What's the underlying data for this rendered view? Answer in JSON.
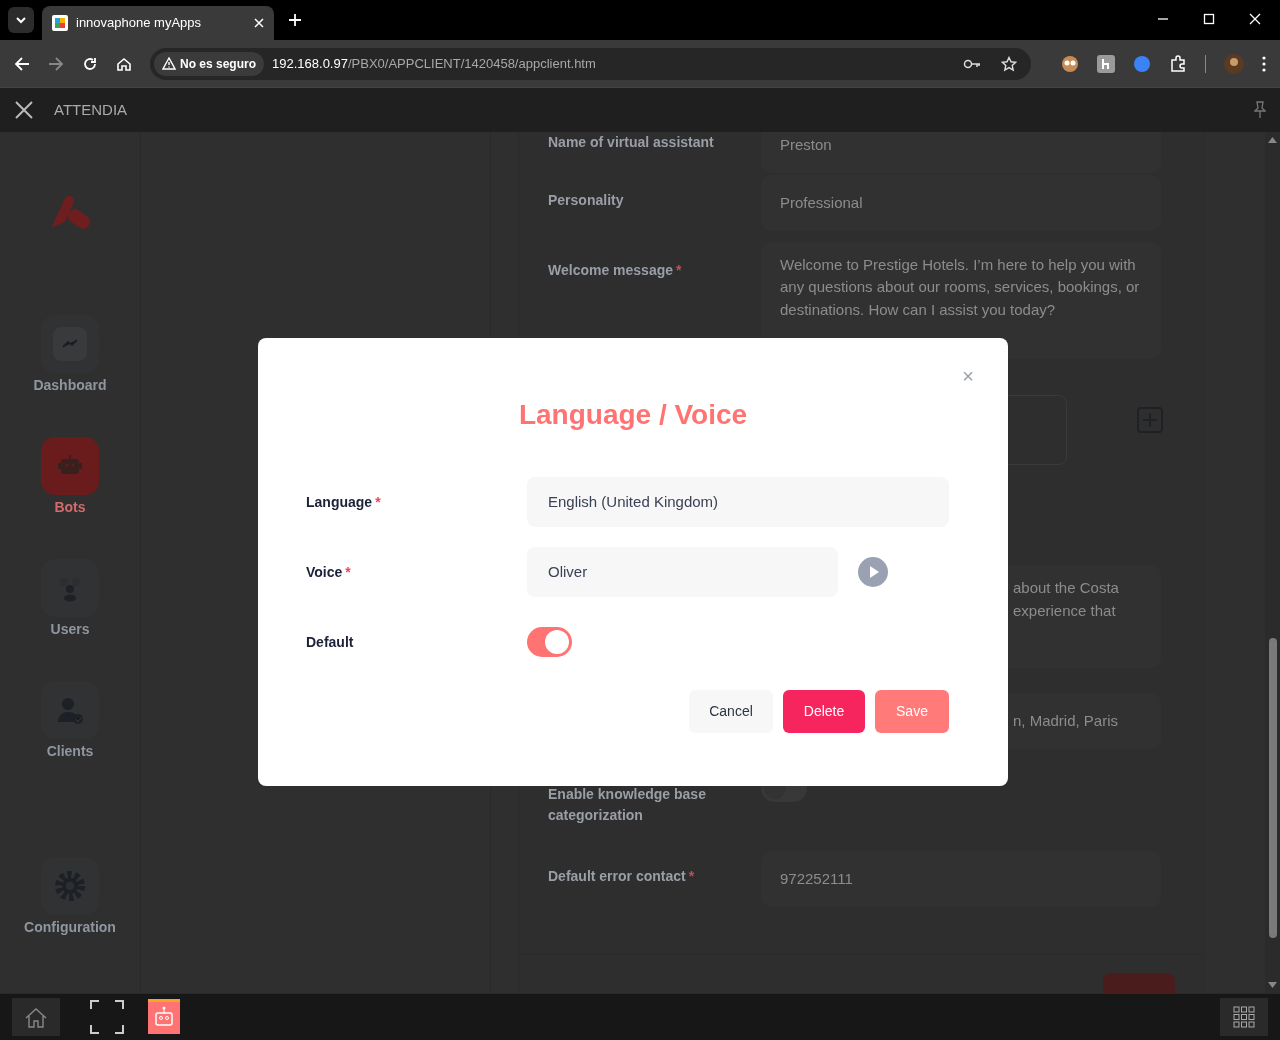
{
  "browser": {
    "tab_title": "innovaphone myApps",
    "security_label": "No es seguro",
    "url_host": "192.168.0.97",
    "url_path": "/PBX0/APPCLIENT/1420458/appclient.htm"
  },
  "app_header": {
    "title": "ATTENDIA"
  },
  "sidebar": {
    "items": [
      {
        "kind": "dashboard",
        "label": "Dashboard",
        "selected": false
      },
      {
        "kind": "bots",
        "label": "Bots",
        "selected": true
      },
      {
        "kind": "users",
        "label": "Users",
        "selected": false
      },
      {
        "kind": "clients",
        "label": "Clients",
        "selected": false
      },
      {
        "kind": "configuration",
        "label": "Configuration",
        "selected": false
      }
    ]
  },
  "background_form": {
    "fields": [
      {
        "kind": "text",
        "label": "Name of virtual assistant",
        "value": "Preston"
      },
      {
        "kind": "text",
        "label": "Personality",
        "value": "Professional"
      },
      {
        "kind": "textarea",
        "label": "Welcome message",
        "required_mark": "*",
        "value": "Welcome to Prestige Hotels. I’m here to help you with any questions about our rooms, services, bookings, or destinations. How can I assist you today?"
      },
      {
        "kind": "add"
      },
      {
        "kind": "fragment",
        "value": "about the Costa\nexperience that"
      },
      {
        "kind": "fragment_line",
        "value": "n, Madrid, Paris"
      },
      {
        "kind": "toggle",
        "label": "Enable knowledge base categorization",
        "on": false
      },
      {
        "kind": "text",
        "label": "Default error contact",
        "required_mark": "*",
        "value": "972252111"
      }
    ]
  },
  "modal": {
    "title": "Language / Voice",
    "close": "×",
    "fields": [
      {
        "kind": "select",
        "label": "Language",
        "required_mark": "*",
        "value": "English (United Kingdom)"
      },
      {
        "kind": "voice",
        "label": "Voice",
        "required_mark": "*",
        "value": "Oliver"
      },
      {
        "kind": "toggle",
        "label": "Default",
        "on": true
      }
    ],
    "buttons": [
      {
        "kind": "cancel",
        "label": "Cancel"
      },
      {
        "kind": "delete",
        "label": "Delete"
      },
      {
        "kind": "save",
        "label": "Save"
      }
    ]
  }
}
